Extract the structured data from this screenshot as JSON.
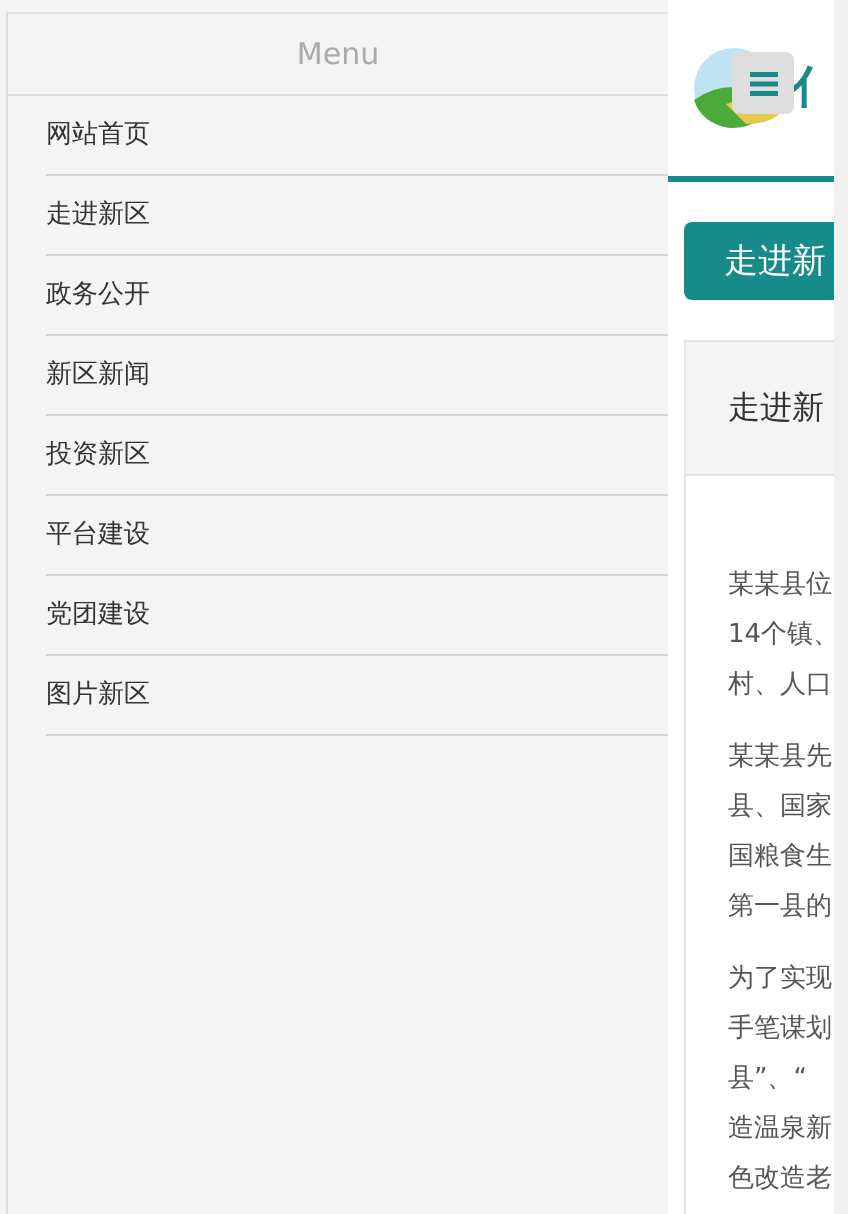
{
  "menu": {
    "title": "Menu",
    "items": [
      {
        "label": "网站首页"
      },
      {
        "label": "走进新区"
      },
      {
        "label": "政务公开"
      },
      {
        "label": "新区新闻"
      },
      {
        "label": "投资新区"
      },
      {
        "label": "平台建设"
      },
      {
        "label": "党团建设"
      },
      {
        "label": "图片新区"
      }
    ]
  },
  "header": {
    "title": "亻"
  },
  "section_button": "走进新",
  "card": {
    "title": "走进新",
    "paragraphs": [
      {
        "lines": [
          "某某县位",
          "14个镇、",
          "村、人口"
        ]
      },
      {
        "lines": [
          "某某县先",
          "县、国家",
          "国粮食生",
          "第一县的"
        ]
      },
      {
        "lines": [
          "为了实现",
          "手笔谋划",
          "县”、“",
          "造温泉新",
          "色改造老"
        ]
      }
    ]
  }
}
